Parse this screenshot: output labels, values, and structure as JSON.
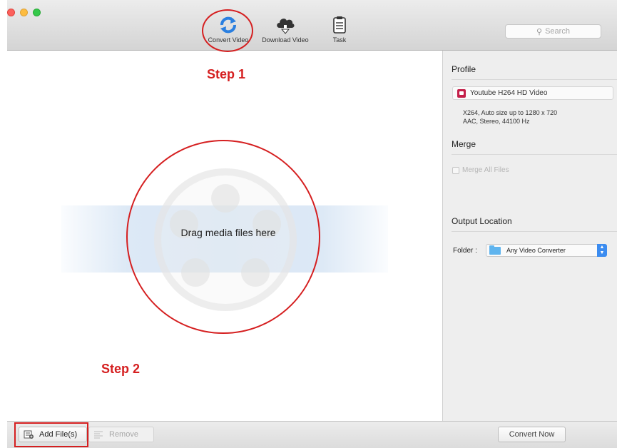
{
  "window": {
    "controls": [
      "close",
      "minimize",
      "maximize"
    ]
  },
  "toolbar": {
    "items": [
      {
        "label": "Convert Video",
        "icon": "convert-icon"
      },
      {
        "label": "Download Video",
        "icon": "download-cloud-icon"
      },
      {
        "label": "Task",
        "icon": "clipboard-icon"
      }
    ],
    "search_placeholder": "Search"
  },
  "main": {
    "drop_text": "Drag media files here"
  },
  "annotations": {
    "step1": "Step 1",
    "step2": "Step 2",
    "color": "#d51f20"
  },
  "panel": {
    "profile_title": "Profile",
    "profile_value": "Youtube H264 HD Video",
    "profile_desc_video": "X264, Auto size up to 1280 x 720",
    "profile_desc_audio": "AAC, Stereo, 44100 Hz",
    "merge_title": "Merge",
    "merge_label": "Merge All Files",
    "output_title": "Output Location",
    "folder_label": "Folder :",
    "folder_value": "Any Video Converter"
  },
  "bottom": {
    "add_files": "Add File(s)",
    "remove": "Remove",
    "convert_now": "Convert Now"
  }
}
